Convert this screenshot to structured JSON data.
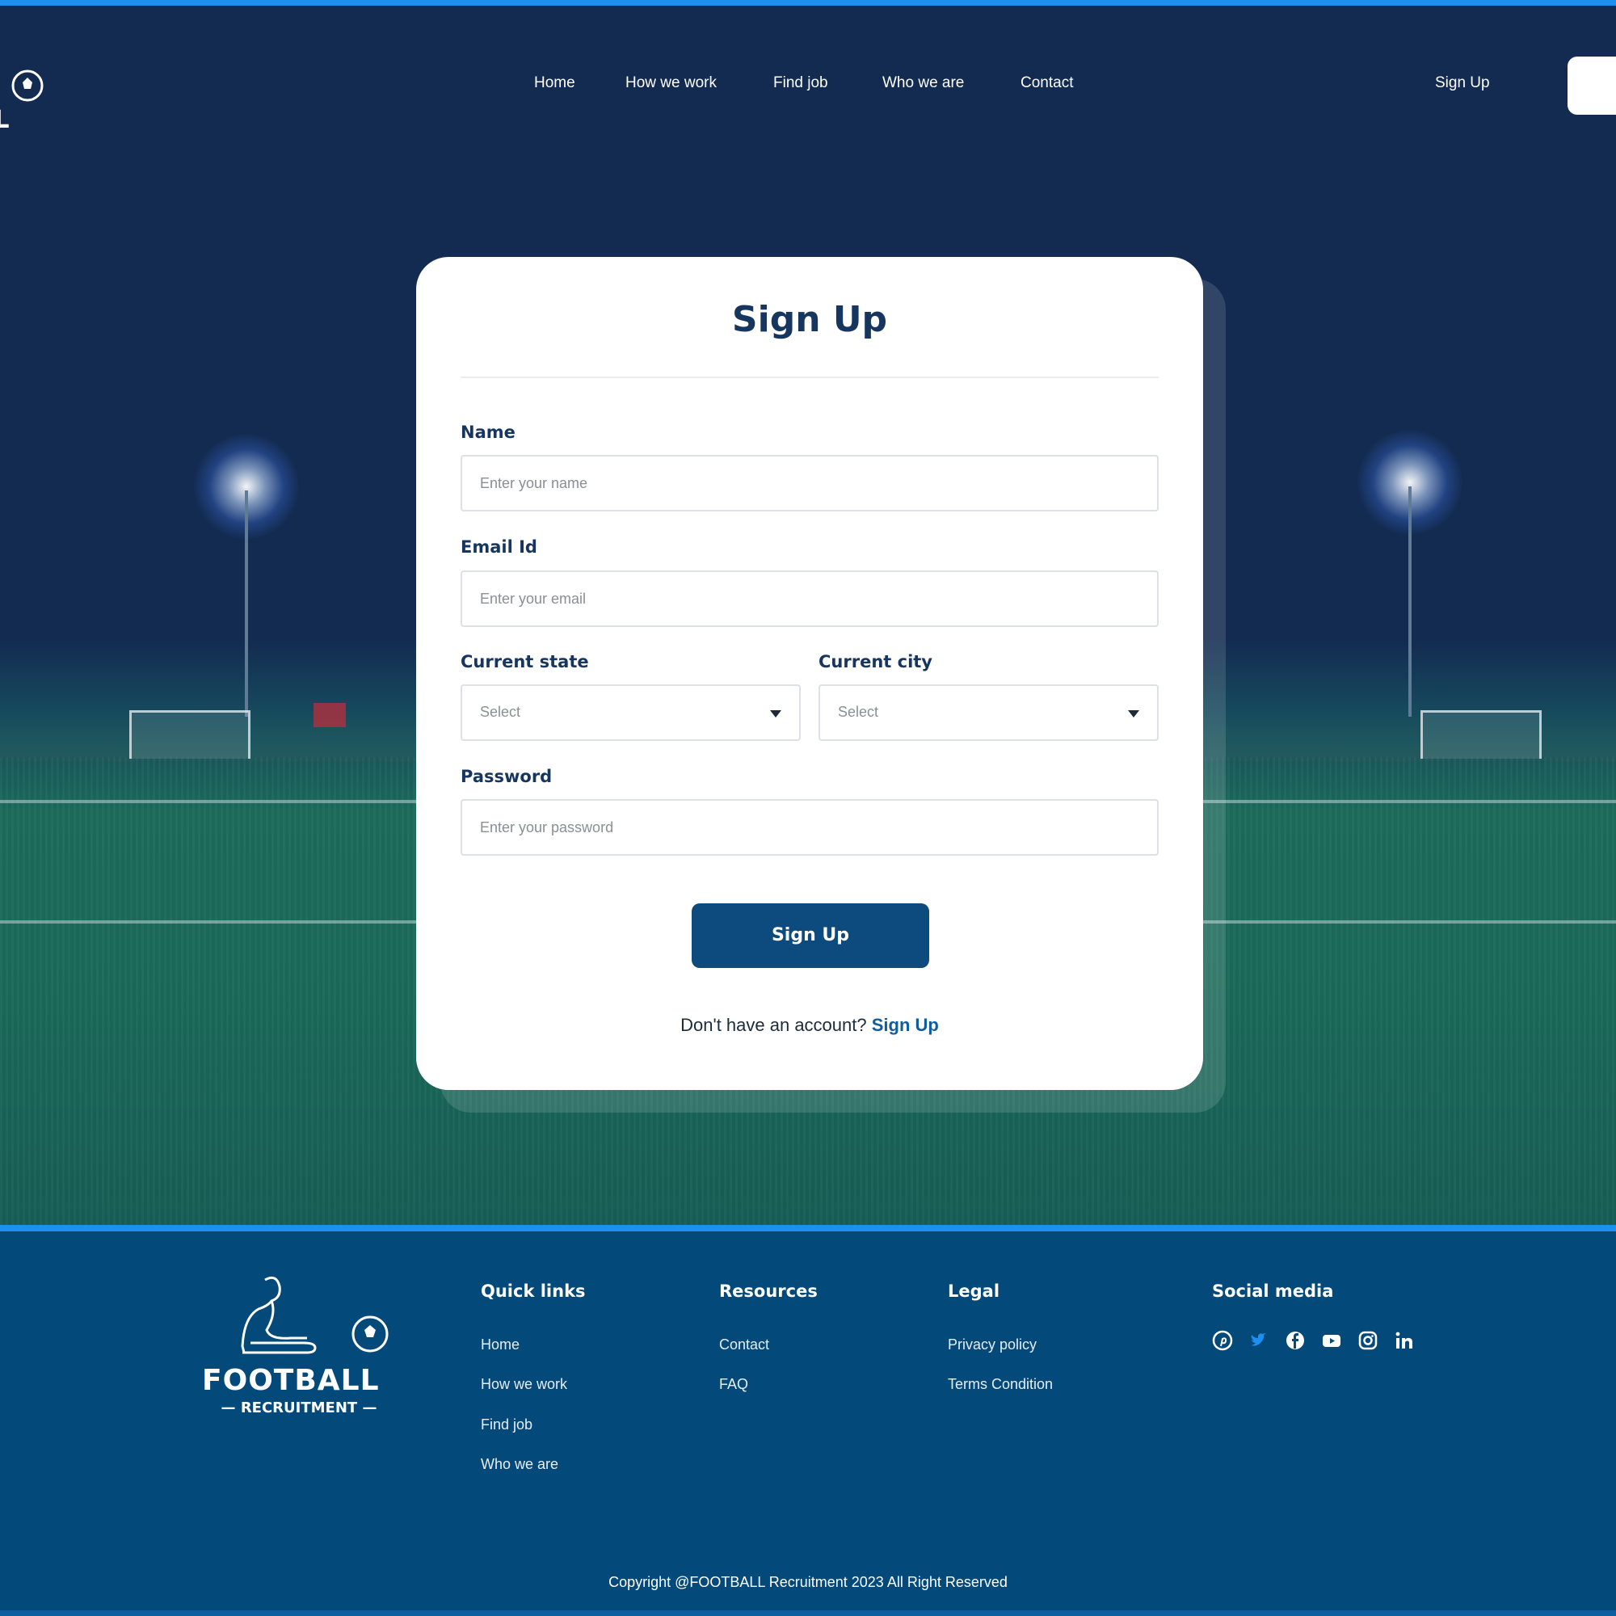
{
  "brand": {
    "line1": "FOOTBALL",
    "line2": "RECRUITMENT"
  },
  "nav": {
    "links": [
      "Home",
      "How we work",
      "Find job",
      "Who we are",
      "Contact"
    ],
    "signup": "Sign Up"
  },
  "form": {
    "title": "Sign Up",
    "name_label": "Name",
    "name_placeholder": "Enter your name",
    "email_label": "Email Id",
    "email_placeholder": "Enter your email",
    "state_label": "Current state",
    "state_value": "Select",
    "city_label": "Current city",
    "city_value": "Select",
    "password_label": "Password",
    "password_placeholder": "Enter your password",
    "submit": "Sign Up",
    "alt_text": "Don't have an account?",
    "alt_link": "Sign Up"
  },
  "footer": {
    "quick_links": {
      "title": "Quick links",
      "items": [
        "Home",
        "How we work",
        "Find job",
        "Who we are"
      ]
    },
    "resources": {
      "title": "Resources",
      "items": [
        "Contact",
        "FAQ"
      ]
    },
    "legal": {
      "title": "Legal",
      "items": [
        "Privacy policy",
        "Terms Condition"
      ]
    },
    "social": {
      "title": "Social media",
      "icons": [
        "pinterest-icon",
        "twitter-icon",
        "facebook-icon",
        "youtube-icon",
        "instagram-icon",
        "linkedin-icon"
      ]
    },
    "copyright": "Copyright @FOOTBALL Recruitment 2023 All Right Reserved"
  },
  "colors": {
    "accent": "#1c8ff2",
    "navy": "#132c52",
    "button": "#0d4a7e",
    "footer": "#03497a",
    "title": "#17365f"
  }
}
